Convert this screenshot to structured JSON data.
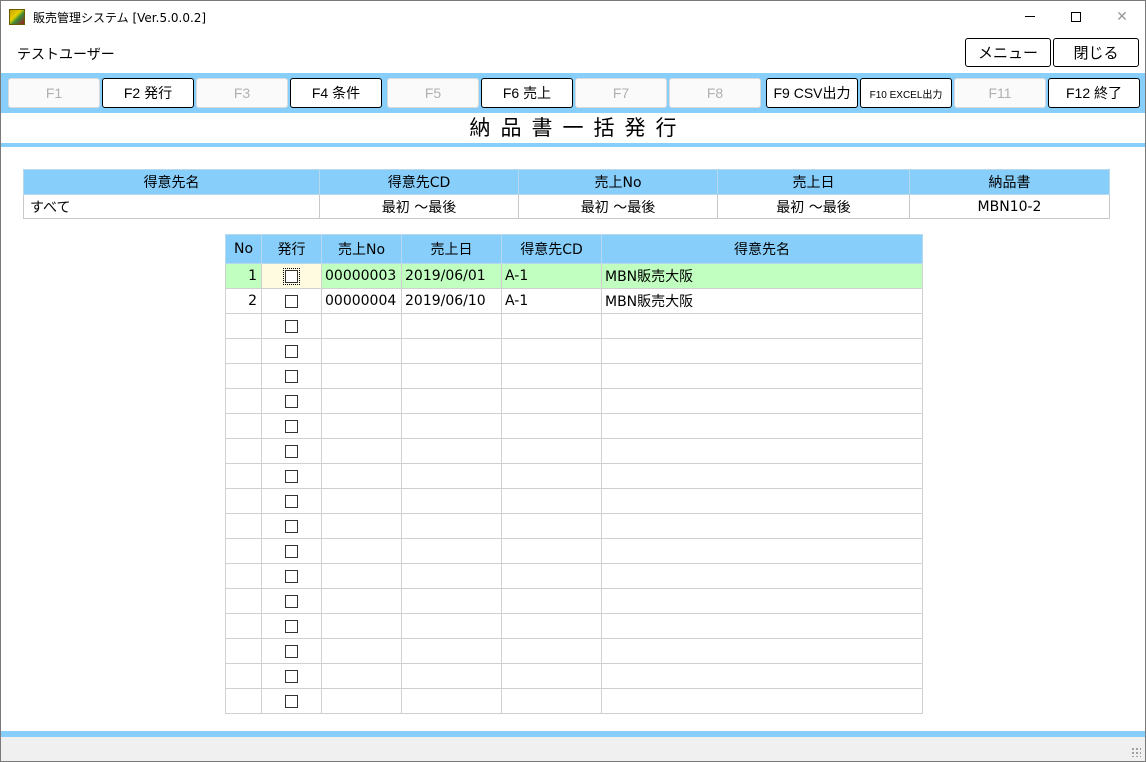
{
  "window": {
    "title": "販売管理システム [Ver.5.0.0.2]",
    "close_glyph": "✕"
  },
  "user": "テストユーザー",
  "top_buttons": {
    "menu": "メニュー",
    "close": "閉じる"
  },
  "fkeys": [
    {
      "label": "F1",
      "enabled": false
    },
    {
      "label": "F2 発行",
      "enabled": true
    },
    {
      "label": "F3",
      "enabled": false
    },
    {
      "label": "F4 条件",
      "enabled": true
    },
    {
      "label": "F5",
      "enabled": false
    },
    {
      "label": "F6 売上",
      "enabled": true
    },
    {
      "label": "F7",
      "enabled": false
    },
    {
      "label": "F8",
      "enabled": false
    },
    {
      "label": "F9 CSV出力",
      "enabled": true
    },
    {
      "label": "F10 EXCEL出力",
      "enabled": true
    },
    {
      "label": "F11",
      "enabled": false
    },
    {
      "label": "F12 終了",
      "enabled": true
    }
  ],
  "page_title": "納品書一括発行",
  "conditions": {
    "headers": [
      "得意先名",
      "得意先CD",
      "売上No",
      "売上日",
      "納品書"
    ],
    "values": [
      "すべて",
      "最初 ～最後",
      "最初 ～最後",
      "最初 ～最後",
      "MBN10-2"
    ]
  },
  "grid": {
    "headers": [
      "No",
      "発行",
      "売上No",
      "売上日",
      "得意先CD",
      "得意先名"
    ],
    "rows": [
      {
        "no": "1",
        "checked": false,
        "sales_no": "00000003",
        "date": "2019/06/01",
        "cust_cd": "A-1",
        "cust_name": "MBN販売大阪"
      },
      {
        "no": "2",
        "checked": false,
        "sales_no": "00000004",
        "date": "2019/06/10",
        "cust_cd": "A-1",
        "cust_name": "MBN販売大阪"
      },
      {
        "no": "",
        "checked": false,
        "sales_no": "",
        "date": "",
        "cust_cd": "",
        "cust_name": ""
      },
      {
        "no": "",
        "checked": false,
        "sales_no": "",
        "date": "",
        "cust_cd": "",
        "cust_name": ""
      },
      {
        "no": "",
        "checked": false,
        "sales_no": "",
        "date": "",
        "cust_cd": "",
        "cust_name": ""
      },
      {
        "no": "",
        "checked": false,
        "sales_no": "",
        "date": "",
        "cust_cd": "",
        "cust_name": ""
      },
      {
        "no": "",
        "checked": false,
        "sales_no": "",
        "date": "",
        "cust_cd": "",
        "cust_name": ""
      },
      {
        "no": "",
        "checked": false,
        "sales_no": "",
        "date": "",
        "cust_cd": "",
        "cust_name": ""
      },
      {
        "no": "",
        "checked": false,
        "sales_no": "",
        "date": "",
        "cust_cd": "",
        "cust_name": ""
      },
      {
        "no": "",
        "checked": false,
        "sales_no": "",
        "date": "",
        "cust_cd": "",
        "cust_name": ""
      },
      {
        "no": "",
        "checked": false,
        "sales_no": "",
        "date": "",
        "cust_cd": "",
        "cust_name": ""
      },
      {
        "no": "",
        "checked": false,
        "sales_no": "",
        "date": "",
        "cust_cd": "",
        "cust_name": ""
      },
      {
        "no": "",
        "checked": false,
        "sales_no": "",
        "date": "",
        "cust_cd": "",
        "cust_name": ""
      },
      {
        "no": "",
        "checked": false,
        "sales_no": "",
        "date": "",
        "cust_cd": "",
        "cust_name": ""
      },
      {
        "no": "",
        "checked": false,
        "sales_no": "",
        "date": "",
        "cust_cd": "",
        "cust_name": ""
      },
      {
        "no": "",
        "checked": false,
        "sales_no": "",
        "date": "",
        "cust_cd": "",
        "cust_name": ""
      },
      {
        "no": "",
        "checked": false,
        "sales_no": "",
        "date": "",
        "cust_cd": "",
        "cust_name": ""
      },
      {
        "no": "",
        "checked": false,
        "sales_no": "",
        "date": "",
        "cust_cd": "",
        "cust_name": ""
      }
    ]
  },
  "colors": {
    "accent": "#87cefa",
    "selected_row": "#c0ffc0"
  }
}
